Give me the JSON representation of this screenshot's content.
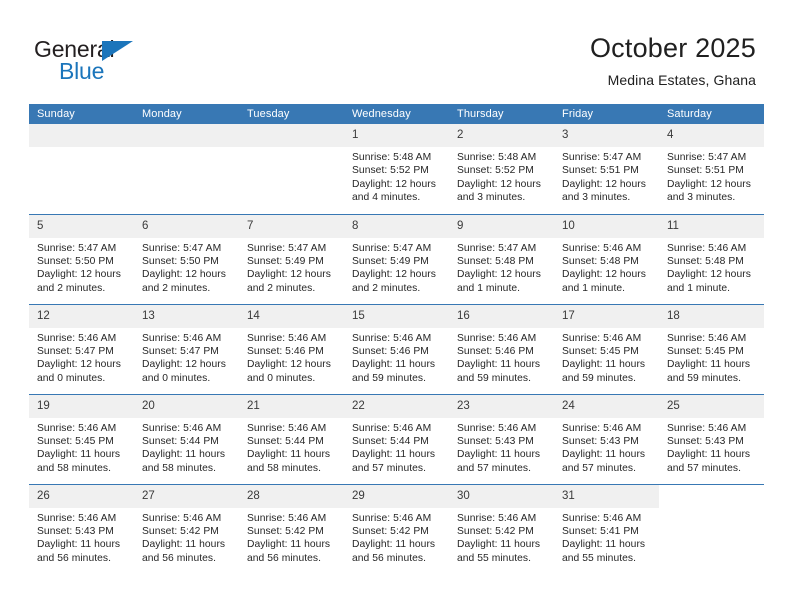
{
  "brand": {
    "name_top": "General",
    "name_bottom": "Blue"
  },
  "header": {
    "title": "October 2025",
    "subtitle": "Medina Estates, Ghana"
  },
  "colors": {
    "header_blue": "#3878b4",
    "brand_blue": "#1b75bb",
    "daynum_bg": "#f0f0f0",
    "text": "#262626"
  },
  "weekday_headers": [
    "Sunday",
    "Monday",
    "Tuesday",
    "Wednesday",
    "Thursday",
    "Friday",
    "Saturday"
  ],
  "weeks": [
    [
      {
        "day": "",
        "lines": []
      },
      {
        "day": "",
        "lines": []
      },
      {
        "day": "",
        "lines": []
      },
      {
        "day": "1",
        "lines": [
          "Sunrise: 5:48 AM",
          "Sunset: 5:52 PM",
          "Daylight: 12 hours",
          "and 4 minutes."
        ]
      },
      {
        "day": "2",
        "lines": [
          "Sunrise: 5:48 AM",
          "Sunset: 5:52 PM",
          "Daylight: 12 hours",
          "and 3 minutes."
        ]
      },
      {
        "day": "3",
        "lines": [
          "Sunrise: 5:47 AM",
          "Sunset: 5:51 PM",
          "Daylight: 12 hours",
          "and 3 minutes."
        ]
      },
      {
        "day": "4",
        "lines": [
          "Sunrise: 5:47 AM",
          "Sunset: 5:51 PM",
          "Daylight: 12 hours",
          "and 3 minutes."
        ]
      }
    ],
    [
      {
        "day": "5",
        "lines": [
          "Sunrise: 5:47 AM",
          "Sunset: 5:50 PM",
          "Daylight: 12 hours",
          "and 2 minutes."
        ]
      },
      {
        "day": "6",
        "lines": [
          "Sunrise: 5:47 AM",
          "Sunset: 5:50 PM",
          "Daylight: 12 hours",
          "and 2 minutes."
        ]
      },
      {
        "day": "7",
        "lines": [
          "Sunrise: 5:47 AM",
          "Sunset: 5:49 PM",
          "Daylight: 12 hours",
          "and 2 minutes."
        ]
      },
      {
        "day": "8",
        "lines": [
          "Sunrise: 5:47 AM",
          "Sunset: 5:49 PM",
          "Daylight: 12 hours",
          "and 2 minutes."
        ]
      },
      {
        "day": "9",
        "lines": [
          "Sunrise: 5:47 AM",
          "Sunset: 5:48 PM",
          "Daylight: 12 hours",
          "and 1 minute."
        ]
      },
      {
        "day": "10",
        "lines": [
          "Sunrise: 5:46 AM",
          "Sunset: 5:48 PM",
          "Daylight: 12 hours",
          "and 1 minute."
        ]
      },
      {
        "day": "11",
        "lines": [
          "Sunrise: 5:46 AM",
          "Sunset: 5:48 PM",
          "Daylight: 12 hours",
          "and 1 minute."
        ]
      }
    ],
    [
      {
        "day": "12",
        "lines": [
          "Sunrise: 5:46 AM",
          "Sunset: 5:47 PM",
          "Daylight: 12 hours",
          "and 0 minutes."
        ]
      },
      {
        "day": "13",
        "lines": [
          "Sunrise: 5:46 AM",
          "Sunset: 5:47 PM",
          "Daylight: 12 hours",
          "and 0 minutes."
        ]
      },
      {
        "day": "14",
        "lines": [
          "Sunrise: 5:46 AM",
          "Sunset: 5:46 PM",
          "Daylight: 12 hours",
          "and 0 minutes."
        ]
      },
      {
        "day": "15",
        "lines": [
          "Sunrise: 5:46 AM",
          "Sunset: 5:46 PM",
          "Daylight: 11 hours",
          "and 59 minutes."
        ]
      },
      {
        "day": "16",
        "lines": [
          "Sunrise: 5:46 AM",
          "Sunset: 5:46 PM",
          "Daylight: 11 hours",
          "and 59 minutes."
        ]
      },
      {
        "day": "17",
        "lines": [
          "Sunrise: 5:46 AM",
          "Sunset: 5:45 PM",
          "Daylight: 11 hours",
          "and 59 minutes."
        ]
      },
      {
        "day": "18",
        "lines": [
          "Sunrise: 5:46 AM",
          "Sunset: 5:45 PM",
          "Daylight: 11 hours",
          "and 59 minutes."
        ]
      }
    ],
    [
      {
        "day": "19",
        "lines": [
          "Sunrise: 5:46 AM",
          "Sunset: 5:45 PM",
          "Daylight: 11 hours",
          "and 58 minutes."
        ]
      },
      {
        "day": "20",
        "lines": [
          "Sunrise: 5:46 AM",
          "Sunset: 5:44 PM",
          "Daylight: 11 hours",
          "and 58 minutes."
        ]
      },
      {
        "day": "21",
        "lines": [
          "Sunrise: 5:46 AM",
          "Sunset: 5:44 PM",
          "Daylight: 11 hours",
          "and 58 minutes."
        ]
      },
      {
        "day": "22",
        "lines": [
          "Sunrise: 5:46 AM",
          "Sunset: 5:44 PM",
          "Daylight: 11 hours",
          "and 57 minutes."
        ]
      },
      {
        "day": "23",
        "lines": [
          "Sunrise: 5:46 AM",
          "Sunset: 5:43 PM",
          "Daylight: 11 hours",
          "and 57 minutes."
        ]
      },
      {
        "day": "24",
        "lines": [
          "Sunrise: 5:46 AM",
          "Sunset: 5:43 PM",
          "Daylight: 11 hours",
          "and 57 minutes."
        ]
      },
      {
        "day": "25",
        "lines": [
          "Sunrise: 5:46 AM",
          "Sunset: 5:43 PM",
          "Daylight: 11 hours",
          "and 57 minutes."
        ]
      }
    ],
    [
      {
        "day": "26",
        "lines": [
          "Sunrise: 5:46 AM",
          "Sunset: 5:43 PM",
          "Daylight: 11 hours",
          "and 56 minutes."
        ]
      },
      {
        "day": "27",
        "lines": [
          "Sunrise: 5:46 AM",
          "Sunset: 5:42 PM",
          "Daylight: 11 hours",
          "and 56 minutes."
        ]
      },
      {
        "day": "28",
        "lines": [
          "Sunrise: 5:46 AM",
          "Sunset: 5:42 PM",
          "Daylight: 11 hours",
          "and 56 minutes."
        ]
      },
      {
        "day": "29",
        "lines": [
          "Sunrise: 5:46 AM",
          "Sunset: 5:42 PM",
          "Daylight: 11 hours",
          "and 56 minutes."
        ]
      },
      {
        "day": "30",
        "lines": [
          "Sunrise: 5:46 AM",
          "Sunset: 5:42 PM",
          "Daylight: 11 hours",
          "and 55 minutes."
        ]
      },
      {
        "day": "31",
        "lines": [
          "Sunrise: 5:46 AM",
          "Sunset: 5:41 PM",
          "Daylight: 11 hours",
          "and 55 minutes."
        ]
      },
      {
        "day": "",
        "lines": [],
        "blank": true
      }
    ]
  ]
}
